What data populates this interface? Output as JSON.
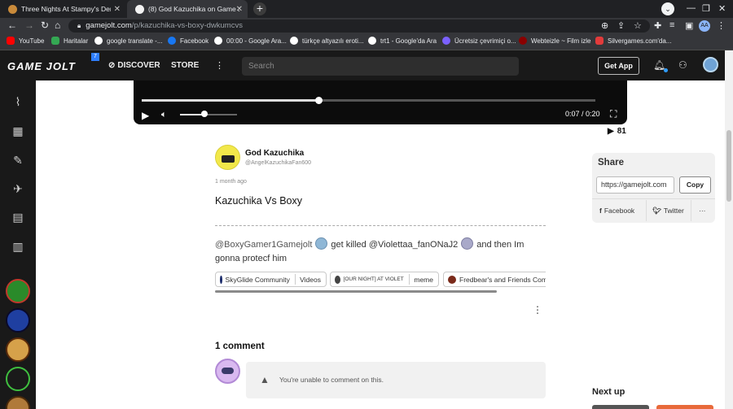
{
  "browser": {
    "tabs": [
      {
        "title": "Three Nights At Stampy's Demak...",
        "active": false,
        "icon_color": "#c98a3a"
      },
      {
        "title": "(8) God Kazuchika on Game Jolt...",
        "active": true,
        "icon_color": "#f3f3f3"
      }
    ],
    "new_tab": "+",
    "url_host": "gamejolt.com",
    "url_path": "/p/kazuchika-vs-boxy-dwkumcvs",
    "profile_label": "AA",
    "bookmarks": [
      {
        "label": "YouTube",
        "color": "#ff0000"
      },
      {
        "label": "Haritalar",
        "color": "#34a853"
      },
      {
        "label": "google translate -...",
        "color": "#ffffff"
      },
      {
        "label": "Facebook",
        "color": "#1877f2"
      },
      {
        "label": "00:00 - Google Ara...",
        "color": "#ffffff"
      },
      {
        "label": "türkçe altyazılı eroti...",
        "color": "#ffffff"
      },
      {
        "label": "trt1 - Google'da Ara",
        "color": "#ffffff"
      },
      {
        "label": "Ücretsiz çevrimiçi o...",
        "color": "#7b61ff"
      },
      {
        "label": "Webteizle ~ Film izle",
        "color": "#8b0000"
      },
      {
        "label": "Silvergames.com'da...",
        "color": "#e23b3b"
      }
    ]
  },
  "gamejolt": {
    "logo": "GAME JOLT",
    "badge": "7",
    "nav_discover": "DISCOVER",
    "nav_store": "STORE",
    "search_placeholder": "Search",
    "get_app": "Get App"
  },
  "video": {
    "progress": 0.39,
    "volume": 0.43,
    "time": "0:07 / 0:20",
    "views": "81"
  },
  "post": {
    "author_name": "God Kazuchika",
    "author_handle": "@AngelKazuchikaFan600",
    "posted": "1 month ago",
    "title": "Kazuchika Vs Boxy",
    "body_part1": "@BoxyGamer1Gamejolt",
    "body_part2": "get killed @Violettaa_fanONaJ2",
    "body_part3": "and then Im gonna protecf him",
    "chips": [
      {
        "name": "SkyGlide Community",
        "sub": "Videos"
      },
      {
        "name": "[OUR NIGHT] AT VIOLET",
        "sub": "meme"
      },
      {
        "name": "Fredbear's and Friends Comm",
        "sub": ""
      }
    ]
  },
  "comments": {
    "title": "1 comment",
    "message": "You're unable to comment on this."
  },
  "share": {
    "title": "Share",
    "url": "https://gamejolt.com",
    "copy": "Copy",
    "facebook": "Facebook",
    "twitter": "Twitter",
    "more": "···"
  },
  "next_up": "Next up"
}
